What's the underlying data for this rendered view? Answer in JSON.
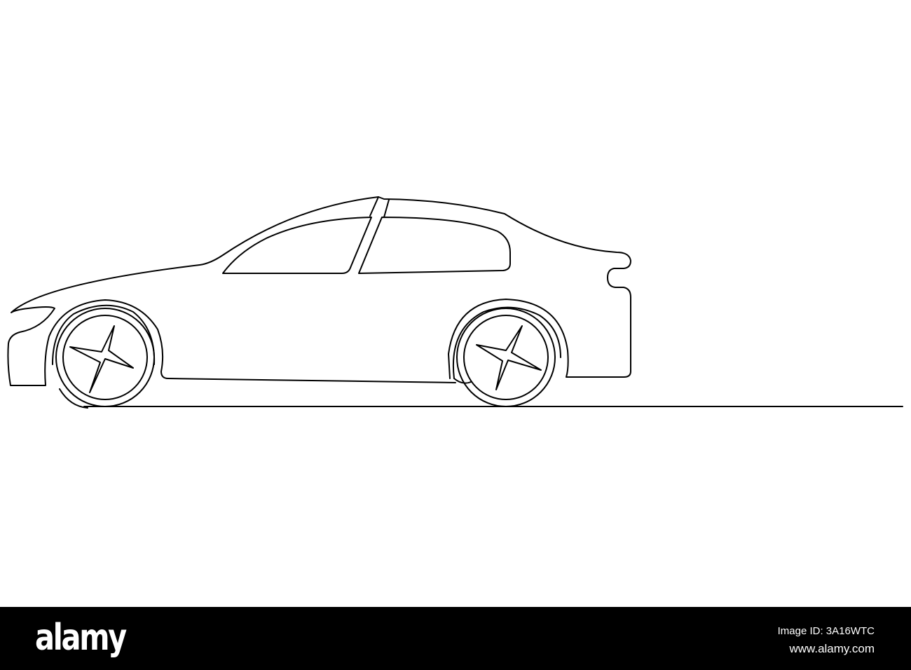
{
  "watermark": {
    "logo": "alamy",
    "image_id": "Image ID: 3A16WTC",
    "url": "www.alamy.com"
  },
  "colors": {
    "line": "#000000",
    "background": "#ffffff",
    "bar": "#000000"
  }
}
